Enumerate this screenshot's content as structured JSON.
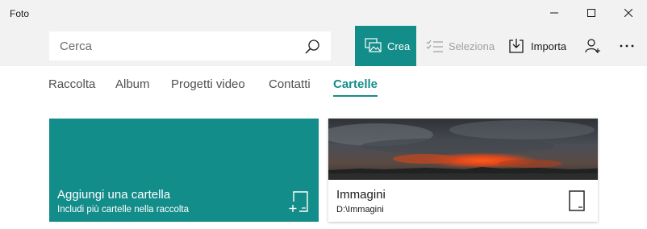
{
  "window": {
    "title": "Foto"
  },
  "search": {
    "placeholder": "Cerca",
    "value": ""
  },
  "toolbar": {
    "crea_label": "Crea",
    "seleziona_label": "Seleziona",
    "importa_label": "Importa"
  },
  "tabs": [
    {
      "label": "Raccolta"
    },
    {
      "label": "Album"
    },
    {
      "label": "Progetti video"
    },
    {
      "label": "Contatti"
    },
    {
      "label": "Cartelle",
      "active": true
    }
  ],
  "add_folder": {
    "title": "Aggiungi una cartella",
    "subtitle": "Includi più cartelle nella raccolta"
  },
  "folder": {
    "name": "Immagini",
    "path": "D:\\Immagini"
  },
  "colors": {
    "accent": "#138d8a",
    "chrome": "#f2f2f2"
  },
  "icons": {
    "search": "search-icon",
    "crea": "create-icon",
    "seleziona": "select-icon",
    "importa": "import-icon",
    "user": "add-user-icon",
    "more": "more-icon",
    "add_folder": "add-folder-icon",
    "folder": "folder-icon"
  }
}
